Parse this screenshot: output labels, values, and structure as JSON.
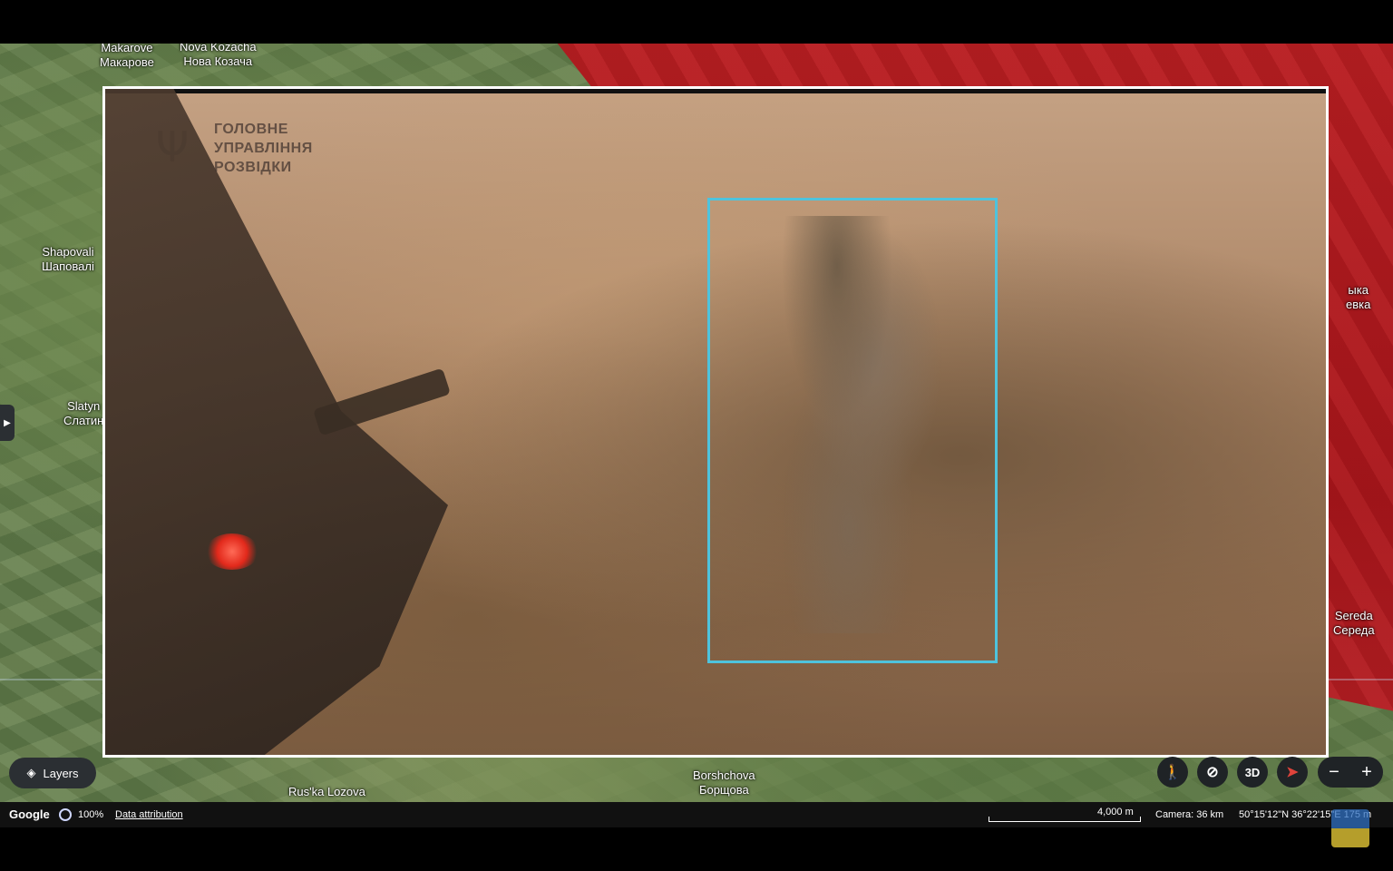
{
  "video": {
    "agency_lines": [
      "ГОЛОВНЕ",
      "УПРАВЛІННЯ",
      "РОЗВІДКИ"
    ],
    "logo_icon": "trident-icon",
    "highlight_color": "#4ec3dd"
  },
  "map": {
    "places": [
      {
        "name": "Makarove",
        "native": "Макарове"
      },
      {
        "name": "Nova Kozacha",
        "native": "Нова Козача"
      },
      {
        "name": "Shapovali",
        "native": "Шаповалі"
      },
      {
        "name": "Slatyn",
        "native": "Слатин"
      },
      {
        "name": "Rus'ka Lozova",
        "native": ""
      },
      {
        "name": "Borshchova",
        "native": "Борщова"
      },
      {
        "name": "ыка",
        "native": "евка"
      },
      {
        "name": "Sereda",
        "native": "Середа"
      }
    ],
    "occupied_color": "#b51e22"
  },
  "controls": {
    "layers_label": "Layers",
    "threed_label": "3D",
    "zoom_out": "−",
    "zoom_in": "+"
  },
  "status": {
    "brand": "Google",
    "load_percent": "100%",
    "attribution": "Data attribution",
    "scale": "4,000 m",
    "camera": "Camera: 36 km",
    "coords": "50°15'12\"N 36°22'15\"E 175 m"
  }
}
